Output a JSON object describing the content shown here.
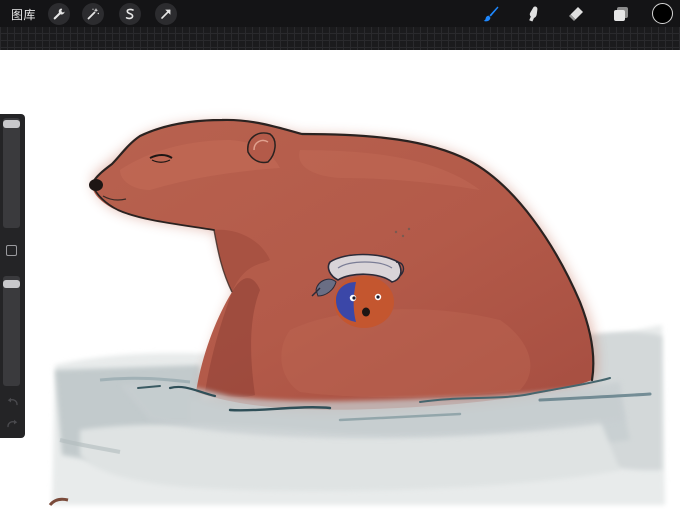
{
  "toolbar": {
    "gallery_label": "图库",
    "left_tools": [
      {
        "name": "actions",
        "icon": "wrench-icon"
      },
      {
        "name": "adjustments",
        "icon": "magic-wand-icon"
      },
      {
        "name": "selection",
        "icon": "selection-s-icon"
      },
      {
        "name": "transform",
        "icon": "arrow-cursor-icon"
      }
    ],
    "right_tools": [
      {
        "name": "brush",
        "icon": "brush-icon",
        "active": true
      },
      {
        "name": "smudge",
        "icon": "smudge-finger-icon",
        "active": false
      },
      {
        "name": "eraser",
        "icon": "eraser-icon",
        "active": false
      },
      {
        "name": "layers",
        "icon": "layers-icon",
        "active": false
      }
    ],
    "current_color": "#000000",
    "active_tool_color": "#1e88ff"
  },
  "sidebar": {
    "brush_size_level": 0.98,
    "opacity_level": 0.96,
    "buttons": [
      "modify-button",
      "undo-arrow-icon",
      "redo-arrow-icon"
    ]
  },
  "canvas": {
    "content": "painting-of-brown-bear-in-water-with-small-creature",
    "colors": {
      "bear": "#b3594a",
      "bear_shadow": "#8e3f34",
      "water": "#bcc4c6",
      "water_dark": "#5d7b84",
      "outline": "#2a2220"
    }
  }
}
